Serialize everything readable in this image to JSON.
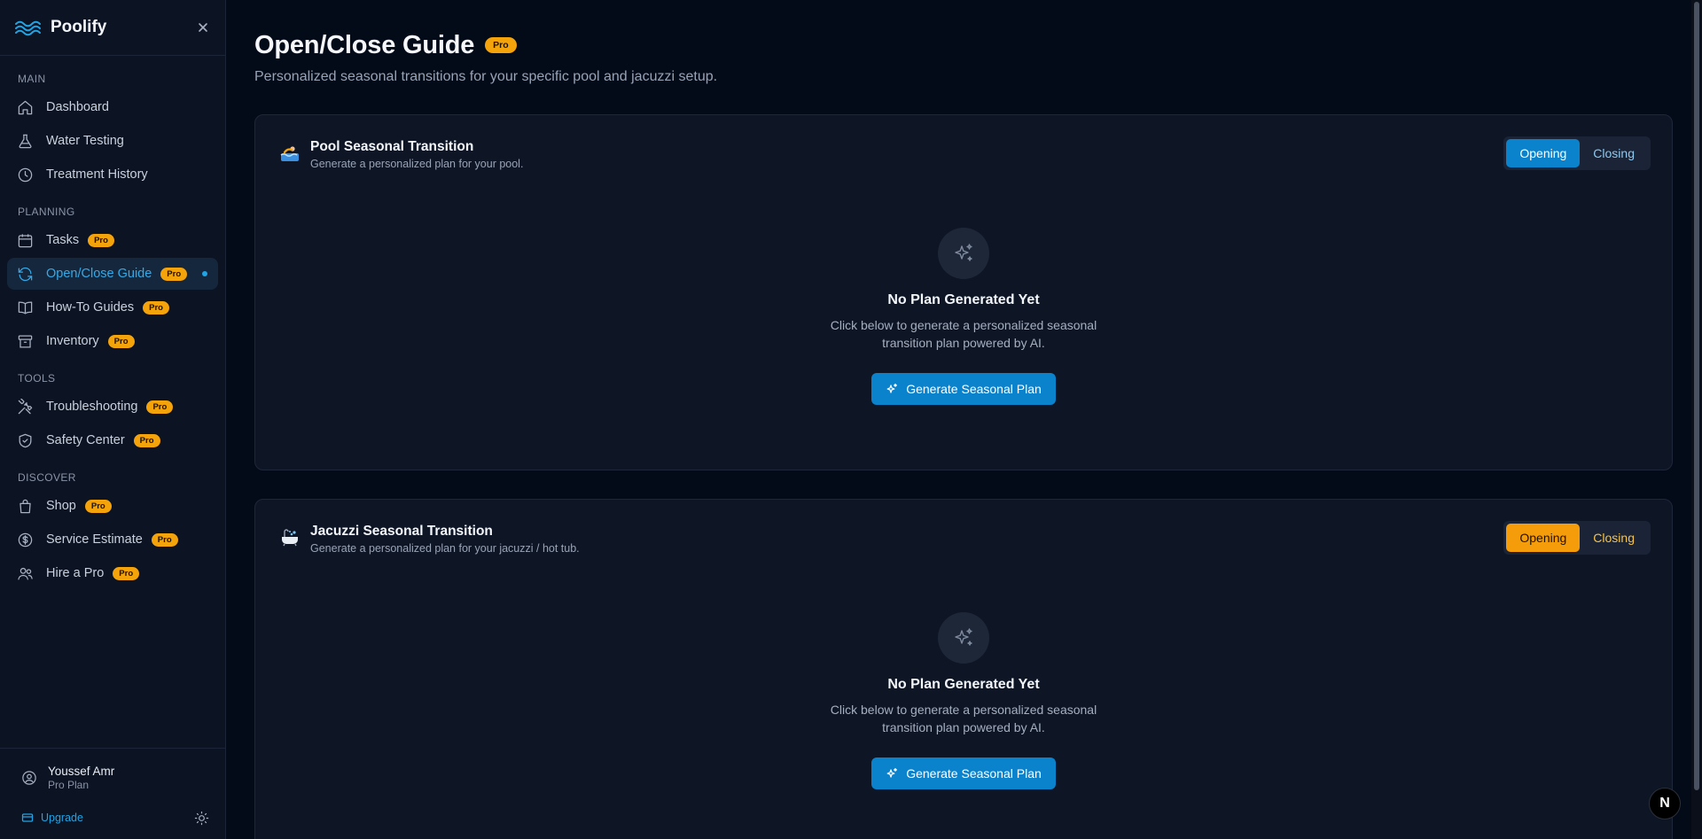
{
  "app": {
    "name": "Poolify"
  },
  "sidebar": {
    "sections": [
      {
        "label": "MAIN",
        "items": [
          {
            "label": "Dashboard",
            "icon": "home-icon",
            "pro": false
          },
          {
            "label": "Water Testing",
            "icon": "flask-icon",
            "pro": false
          },
          {
            "label": "Treatment History",
            "icon": "clock-icon",
            "pro": false
          }
        ]
      },
      {
        "label": "PLANNING",
        "items": [
          {
            "label": "Tasks",
            "icon": "calendar-icon",
            "pro": true
          },
          {
            "label": "Open/Close Guide",
            "icon": "refresh-icon",
            "pro": true,
            "active": true
          },
          {
            "label": "How-To Guides",
            "icon": "book-icon",
            "pro": true
          },
          {
            "label": "Inventory",
            "icon": "archive-icon",
            "pro": true
          }
        ]
      },
      {
        "label": "TOOLS",
        "items": [
          {
            "label": "Troubleshooting",
            "icon": "tools-icon",
            "pro": true
          },
          {
            "label": "Safety Center",
            "icon": "shield-icon",
            "pro": true
          }
        ]
      },
      {
        "label": "DISCOVER",
        "items": [
          {
            "label": "Shop",
            "icon": "shopping-bag-icon",
            "pro": true
          },
          {
            "label": "Service Estimate",
            "icon": "dollar-icon",
            "pro": true
          },
          {
            "label": "Hire a Pro",
            "icon": "users-icon",
            "pro": true
          }
        ]
      }
    ],
    "pro_label": "Pro",
    "user": {
      "name": "Youssef Amr",
      "plan": "Pro Plan"
    },
    "upgrade_label": "Upgrade"
  },
  "page": {
    "title": "Open/Close Guide",
    "badge": "Pro",
    "subtitle": "Personalized seasonal transitions for your specific pool and jacuzzi setup."
  },
  "cards": {
    "pool": {
      "title": "Pool Seasonal Transition",
      "subtitle": "Generate a personalized plan for your pool.",
      "toggle": {
        "opening": "Opening",
        "closing": "Closing",
        "selected": "Opening"
      },
      "empty_title": "No Plan Generated Yet",
      "empty_desc": "Click below to generate a personalized seasonal transition plan powered by AI.",
      "button": "Generate Seasonal Plan"
    },
    "jacuzzi": {
      "title": "Jacuzzi Seasonal Transition",
      "subtitle": "Generate a personalized plan for your jacuzzi / hot tub.",
      "toggle": {
        "opening": "Opening",
        "closing": "Closing",
        "selected": "Opening"
      },
      "empty_title": "No Plan Generated Yet",
      "empty_desc": "Click below to generate a personalized seasonal transition plan powered by AI.",
      "button": "Generate Seasonal Plan"
    }
  },
  "dev_badge": "N",
  "colors": {
    "accent": "#0b83cc",
    "pro": "#f5a30a",
    "jacuzzi_accent": "#f59c0a"
  }
}
